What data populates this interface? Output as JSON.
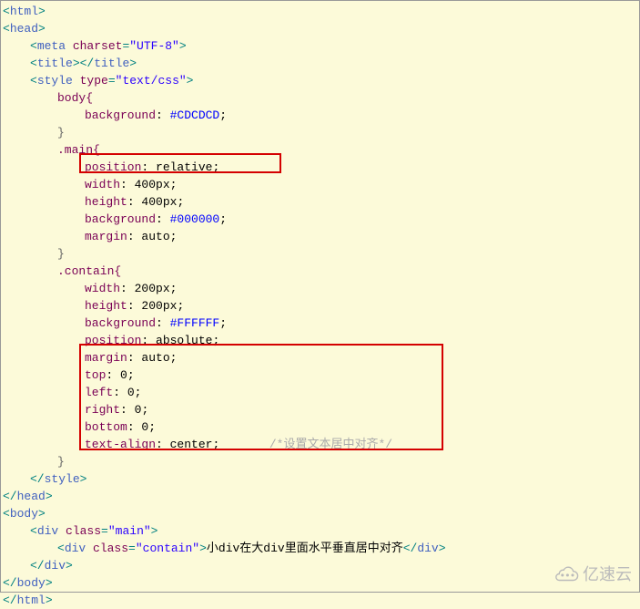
{
  "code": {
    "l1": "<html>",
    "l2": "<head>",
    "l3a": "<meta ",
    "l3b": "charset",
    "l3c": "=",
    "l3d": "\"UTF-8\"",
    "l3e": ">",
    "l4": "<title></title>",
    "l5a": "<style ",
    "l5b": "type",
    "l5c": "=",
    "l5d": "\"text/css\"",
    "l5e": ">",
    "l6": "body{",
    "l7a": "background",
    "l7b": ": ",
    "l7c": "#CDCDCD",
    "l7d": ";",
    "l8": "}",
    "l9": ".main{",
    "l10a": "position",
    "l10b": ": ",
    "l10c": "relative",
    "l10d": ";",
    "l11a": "width",
    "l11b": ": ",
    "l11c": "400px",
    "l11d": ";",
    "l12a": "height",
    "l12b": ": ",
    "l12c": "400px",
    "l12d": ";",
    "l13a": "background",
    "l13b": ": ",
    "l13c": "#000000",
    "l13d": ";",
    "l14a": "margin",
    "l14b": ": ",
    "l14c": "auto",
    "l14d": ";",
    "l15": "}",
    "l16": ".contain{",
    "l17a": "width",
    "l17b": ": ",
    "l17c": "200px",
    "l17d": ";",
    "l18a": "height",
    "l18b": ": ",
    "l18c": "200px",
    "l18d": ";",
    "l19a": "background",
    "l19b": ": ",
    "l19c": "#FFFFFF",
    "l19d": ";",
    "l20a": "position",
    "l20b": ": ",
    "l20c": "absolute",
    "l20d": ";",
    "l21a": "margin",
    "l21b": ": ",
    "l21c": "auto",
    "l21d": ";",
    "l22a": "top",
    "l22b": ": ",
    "l22c": "0",
    "l22d": ";",
    "l23a": "left",
    "l23b": ": ",
    "l23c": "0",
    "l23d": ";",
    "l24a": "right",
    "l24b": ": ",
    "l24c": "0",
    "l24d": ";",
    "l25a": "bottom",
    "l25b": ": ",
    "l25c": "0",
    "l25d": ";",
    "l26a": "text-align",
    "l26b": ": ",
    "l26c": "center",
    "l26d": ";",
    "l26comment": "/*设置文本居中对齐*/",
    "l27": "}",
    "l28": "</style>",
    "l29": "</head>",
    "l30": "<body>",
    "l31a": "<div ",
    "l31b": "class",
    "l31c": "=",
    "l31d": "\"main\"",
    "l31e": ">",
    "l32a": "<div ",
    "l32b": "class",
    "l32c": "=",
    "l32d": "\"contain\"",
    "l32e": ">",
    "l32text": "小div在大div里面水平垂直居中对齐",
    "l32f": "</div>",
    "l33": "</div>",
    "l34": "</body>",
    "l35": "</html>"
  },
  "watermark_text": "亿速云"
}
